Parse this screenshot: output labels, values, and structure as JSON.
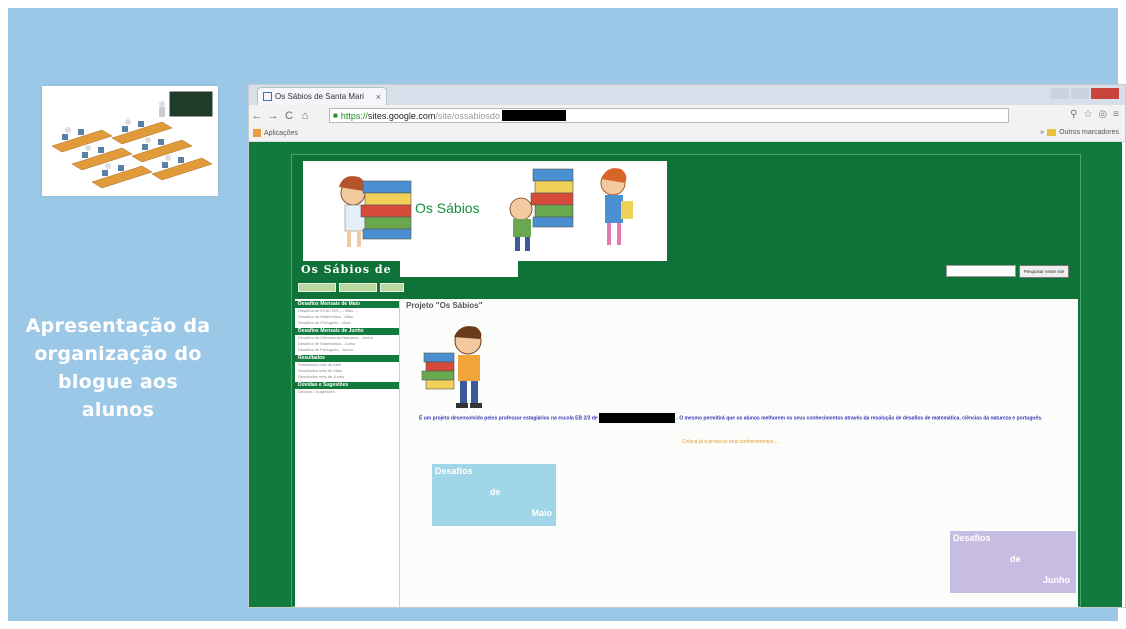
{
  "slide": {
    "caption_lines": [
      "Apresentação da",
      "organização do",
      "blogue aos",
      "alunos"
    ]
  },
  "browser": {
    "tab_title": "Os Sábios de Santa Mari",
    "tab_close": "×",
    "url": {
      "scheme": "https://",
      "host": "sites.google.com",
      "path": "/site/ossabiosdo"
    },
    "bookmarks": {
      "left": "Aplicações",
      "right": "Outros marcadores"
    }
  },
  "site": {
    "banner_text": "Os Sábios",
    "title": "Os Sábios de",
    "search_button": "Pesquisar neste site",
    "sidebar": [
      {
        "heading": "Desafios Mensais de Maio",
        "items": [
          "Desafios de EXACTAS — Maio ...",
          "Desafios de Matemática - Maio",
          "Desafios de Português - Maio"
        ]
      },
      {
        "heading": "Desafios Mensais de Junho",
        "items": [
          "Desafios de Ciências da Natureza - Junho",
          "Desafios de Matemática - Junho",
          "Desafios de Português - Junho"
        ]
      },
      {
        "heading": "Resultados",
        "items": [
          "Resultados mês de Abril",
          "Resultados mês de Maio",
          "Resultados mês de Junho"
        ]
      },
      {
        "heading": "Dúvidas e Sugestões",
        "items": [
          "Dúvidas / Sugestões"
        ]
      }
    ],
    "page_title": "Projeto \"Os Sábios\"",
    "description_before": "É um projeto desenvolvido pelos professor estagiários na escola EB 2/3 de",
    "description_after": ". O mesmo permitirá que os alunos melhorem os seus conhecimentos através da resolução de desafios de matemática, ciências da natureza e português.",
    "cta": "Coloca já à prova os teus conhecimentos....",
    "card_maio": [
      "Desafios",
      "de",
      "Maio"
    ],
    "card_junho": [
      "Desafios",
      "de",
      "Junho"
    ]
  },
  "colors": {
    "slide_bg": "#9cc8e8",
    "site_green": "#117a3d",
    "card_maio": "#9fd6e8",
    "card_junho": "#c7bde3",
    "description": "#3a37b5",
    "cta": "#e39a2b"
  }
}
